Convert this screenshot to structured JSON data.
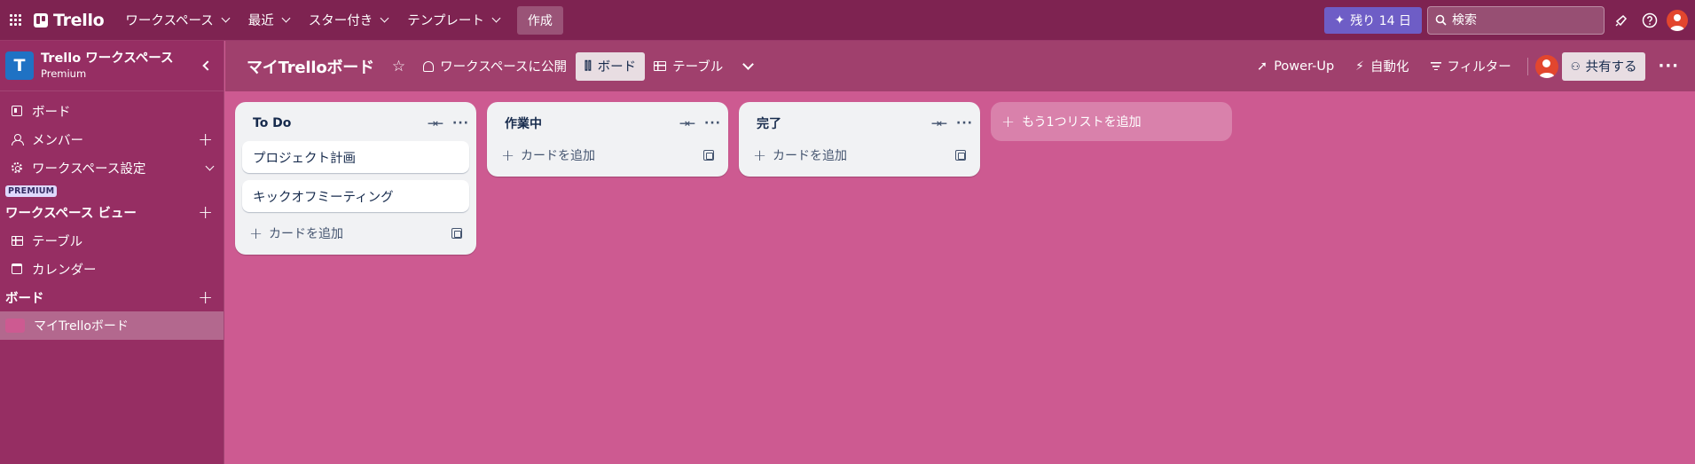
{
  "topbar": {
    "logo": "Trello",
    "nav": [
      "ワークスペース",
      "最近",
      "スター付き",
      "テンプレート"
    ],
    "create": "作成",
    "trial": "残り 14 日",
    "search_placeholder": "検索"
  },
  "sidebar": {
    "workspace_initial": "T",
    "workspace_name": "Trello ワークスペース",
    "workspace_plan": "Premium",
    "items": [
      "ボード",
      "メンバー",
      "ワークスペース設定"
    ],
    "premium_badge": "PREMIUM",
    "views_heading": "ワークスペース ビュー",
    "views": [
      "テーブル",
      "カレンダー"
    ],
    "boards_heading": "ボード",
    "boards": [
      "マイTrelloボード"
    ]
  },
  "board_header": {
    "title": "マイTrelloボード",
    "visibility": "ワークスペースに公開",
    "view_board": "ボード",
    "view_table": "テーブル",
    "powerup": "Power-Up",
    "automation": "自動化",
    "filter": "フィルター",
    "share": "共有する"
  },
  "lists": [
    {
      "title": "To Do",
      "cards": [
        "プロジェクト計画",
        "キックオフミーティング"
      ],
      "add_card": "カードを追加"
    },
    {
      "title": "作業中",
      "cards": [],
      "add_card": "カードを追加"
    },
    {
      "title": "完了",
      "cards": [],
      "add_card": "カードを追加"
    }
  ],
  "add_list": "もう1つリストを追加",
  "colors": {
    "topbar": "#7e2351",
    "sidebar": "#962e63",
    "board_background": "#cd5a91",
    "trial_button": "#6e5dc6"
  }
}
